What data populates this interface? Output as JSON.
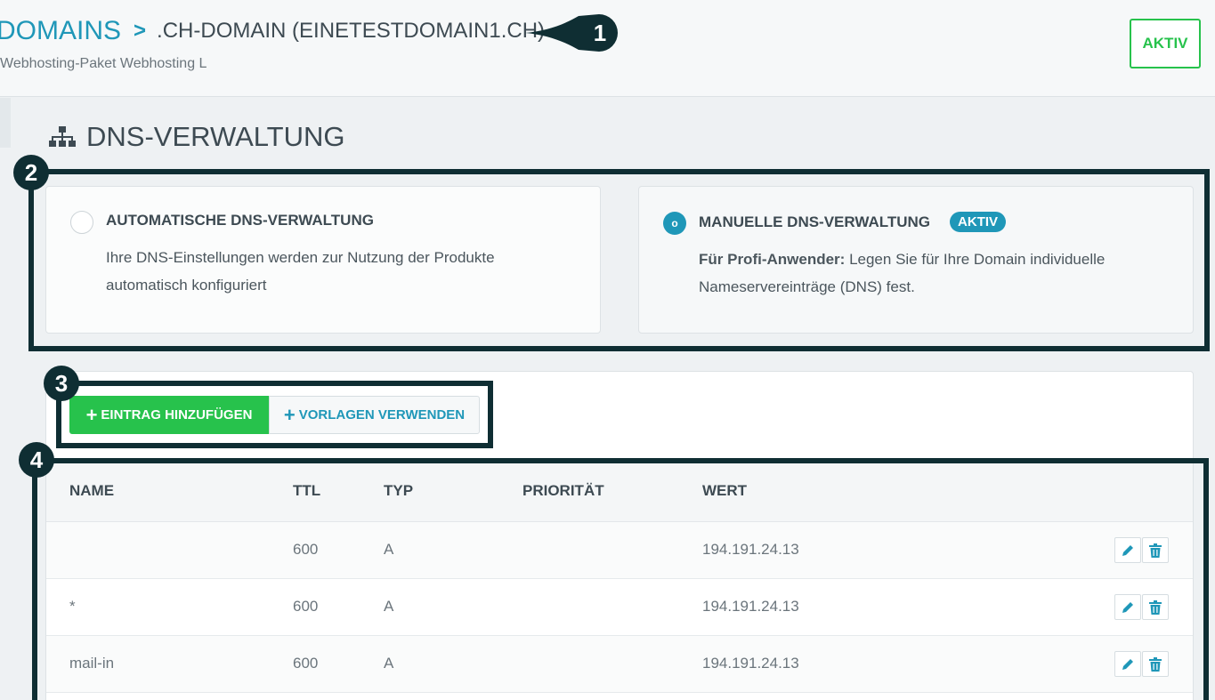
{
  "header": {
    "breadcrumb_root": "DOMAINS",
    "breadcrumb_separator": ">",
    "breadcrumb_current": ".CH-DOMAIN (EINETESTDOMAIN1.CH)",
    "subtitle": "Webhosting-Paket Webhosting L",
    "status_label": "AKTIV"
  },
  "section": {
    "title": "DNS-VERWALTUNG",
    "icon": "sitemap-icon"
  },
  "modes": {
    "automatic": {
      "title": "AUTOMATISCHE DNS-VERWALTUNG",
      "description": "Ihre DNS-Einstellungen werden zur Nutzung der Produkte automatisch konfiguriert",
      "selected": false
    },
    "manual": {
      "title": "MANUELLE DNS-VERWALTUNG",
      "badge": "AKTIV",
      "description_bold": "Für Profi-Anwender:",
      "description": " Legen Sie für Ihre Domain individuelle Nameservereinträge (DNS) fest.",
      "radio_glyph": "o",
      "selected": true
    }
  },
  "actions": {
    "add_entry": "EINTRAG HINZUFÜGEN",
    "use_templates": "VORLAGEN VERWENDEN",
    "plus_glyph": "+"
  },
  "table": {
    "headers": {
      "name": "NAME",
      "ttl": "TTL",
      "type": "TYP",
      "priority": "PRIORITÄT",
      "value": "WERT"
    },
    "rows": [
      {
        "name": "",
        "ttl": "600",
        "type": "A",
        "priority": "",
        "value": "194.191.24.13"
      },
      {
        "name": "*",
        "ttl": "600",
        "type": "A",
        "priority": "",
        "value": "194.191.24.13"
      },
      {
        "name": "mail-in",
        "ttl": "600",
        "type": "A",
        "priority": "",
        "value": "194.191.24.13"
      }
    ]
  },
  "callouts": [
    "1",
    "2",
    "3",
    "4"
  ],
  "colors": {
    "brand_blue": "#1f97b8",
    "success_green": "#27c24c",
    "callout_dark": "#0f2e33"
  }
}
